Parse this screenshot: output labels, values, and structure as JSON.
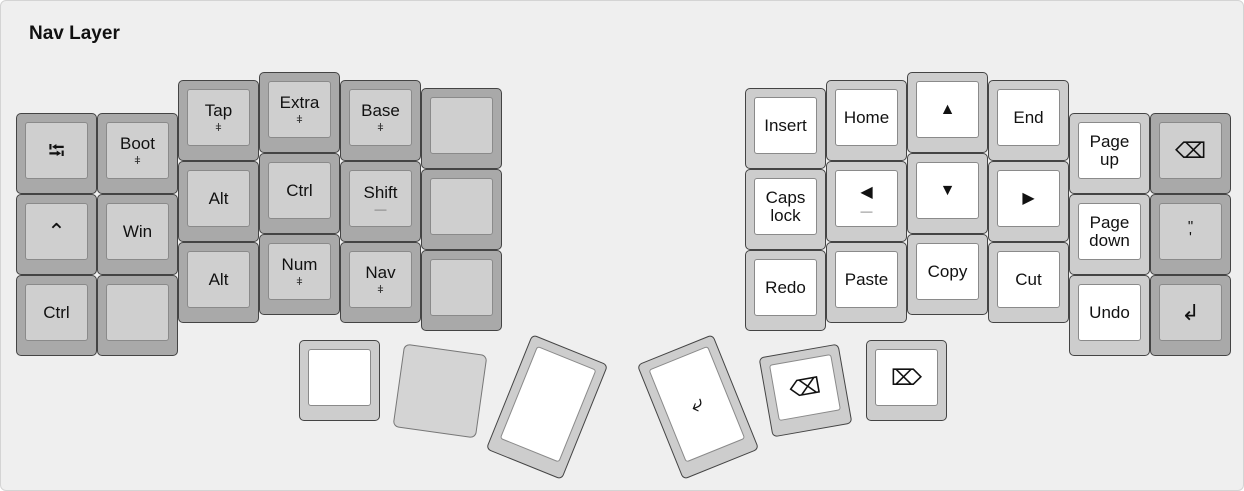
{
  "layer": {
    "title": "Nav Layer"
  },
  "left": {
    "r0": [
      "",
      "Tap",
      "Extra",
      "Base",
      ""
    ],
    "r1": [
      "",
      "Alt",
      "Ctrl",
      "Shift",
      ""
    ],
    "r2": [
      "Ctrl",
      "",
      "Alt",
      "Num",
      "Nav",
      ""
    ],
    "tab_key": "⭾",
    "boot_key": "Boot",
    "up_arrow": "⌃",
    "win_key": "Win",
    "hold_marker": "ǂ",
    "underline_marker": "—"
  },
  "right": {
    "row0": [
      "Insert",
      "Home",
      "▲",
      "End"
    ],
    "row1": [
      "Caps lock",
      "◀",
      "▼",
      "▶"
    ],
    "row2": [
      "Redo",
      "Paste",
      "Copy",
      "Cut"
    ],
    "page_up": "Page up",
    "page_down": "Page down",
    "undo": "Undo",
    "backspace": "⌫",
    "quote": "\"\n'",
    "enter": "↲"
  },
  "thumbs": {
    "left": [
      "",
      "",
      ""
    ],
    "right": [
      "⤶",
      "⌫",
      "⌦"
    ]
  },
  "colors": {
    "background": "#efefef",
    "key_dark": "#a9a9a9",
    "key_light": "#cdcdcd",
    "cap_white": "#ffffff"
  }
}
